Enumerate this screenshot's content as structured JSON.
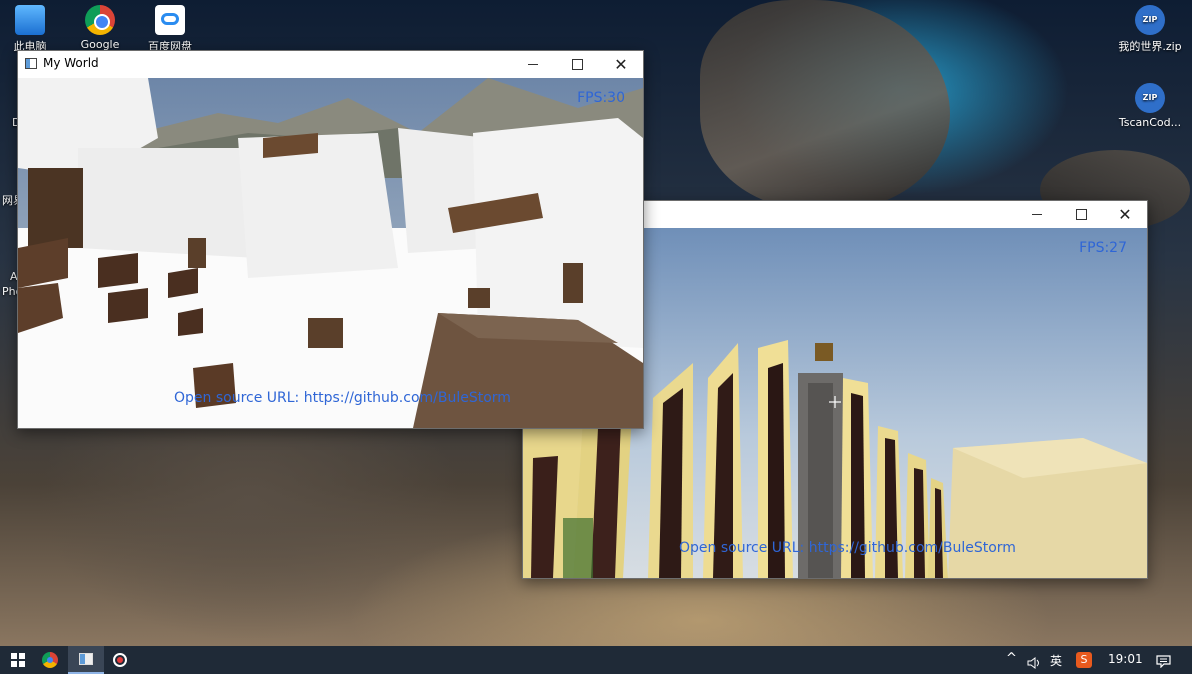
{
  "desktop": {
    "icons": [
      {
        "label": "此电脑",
        "icon": "computer-icon"
      },
      {
        "label": "Google",
        "icon": "chrome-icon"
      },
      {
        "label": "百度网盘",
        "icon": "baidu-netdisk-icon"
      },
      {
        "label": "我的世界.zip",
        "icon": "zip-icon"
      },
      {
        "label": "TscanCod...",
        "icon": "zip-icon"
      }
    ],
    "clipped_labels": [
      "D",
      "网易",
      "A",
      "Pho"
    ]
  },
  "window1": {
    "title": "My World",
    "fps": "FPS:30",
    "url_text": "Open source URL: https://github.com/BuleStorm"
  },
  "window2": {
    "title": "",
    "fps": "FPS:27",
    "url_text": "Open source URL: https://github.com/BuleStorm"
  },
  "taskbar": {
    "items": [
      "windows-start-icon",
      "chrome-icon",
      "my-world-app-icon",
      "recorder-icon"
    ],
    "tray": {
      "ime": "英",
      "time": "19:01"
    }
  },
  "colors": {
    "overlay_text": "#2f66d6",
    "taskbar": "#1f2a37"
  }
}
